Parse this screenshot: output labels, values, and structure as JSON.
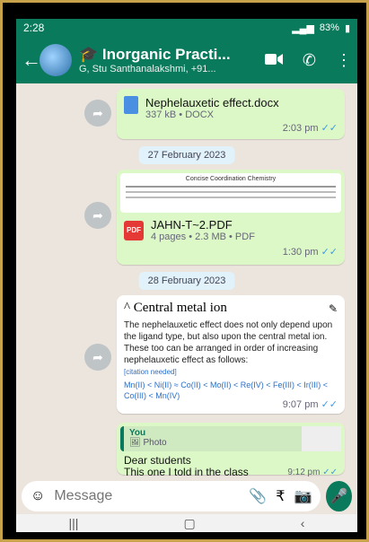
{
  "status": {
    "time": "2:28",
    "battery": "83%"
  },
  "header": {
    "title": "Inorganic Practi...",
    "subtitle": "G, Stu Santhanalakshmi, +91...",
    "cap_icon": "graduation-cap-icon"
  },
  "messages": {
    "doc1": {
      "name": "Nephelauxetic effect.docx",
      "meta": "337 kB • DOCX",
      "time": "2:03 pm"
    },
    "date1": "27 February 2023",
    "pdf1": {
      "preview_text": "Concise Coordination Chemistry",
      "name": "JAHN-T~2.PDF",
      "meta": "4 pages • 2.3 MB • PDF",
      "time": "1:30 pm"
    },
    "date2": "28 February 2023",
    "excerpt": {
      "heading": "Central metal ion",
      "body": "The nephelauxetic effect does not only depend upon the ligand type, but also upon the central metal ion. These too can be arranged in order of increasing nephelauxetic effect as follows:",
      "citation": "[citation needed]",
      "series": "Mn(II) < Ni(II) ≈ Co(II) < Mo(II) < Re(IV) < Fe(III) < Ir(III) < Co(III) < Mn(IV)",
      "time": "9:07 pm"
    },
    "reply": {
      "quoted_author": "You",
      "quoted_type": "Photo",
      "text_line1": "Dear students",
      "text_line2": "This one I told in the class",
      "time": "9:12 pm"
    }
  },
  "composer": {
    "placeholder": "Message"
  },
  "colors": {
    "header": "#0a7a5c",
    "bubble": "#dcf8c6",
    "tick": "#3d9be9"
  }
}
